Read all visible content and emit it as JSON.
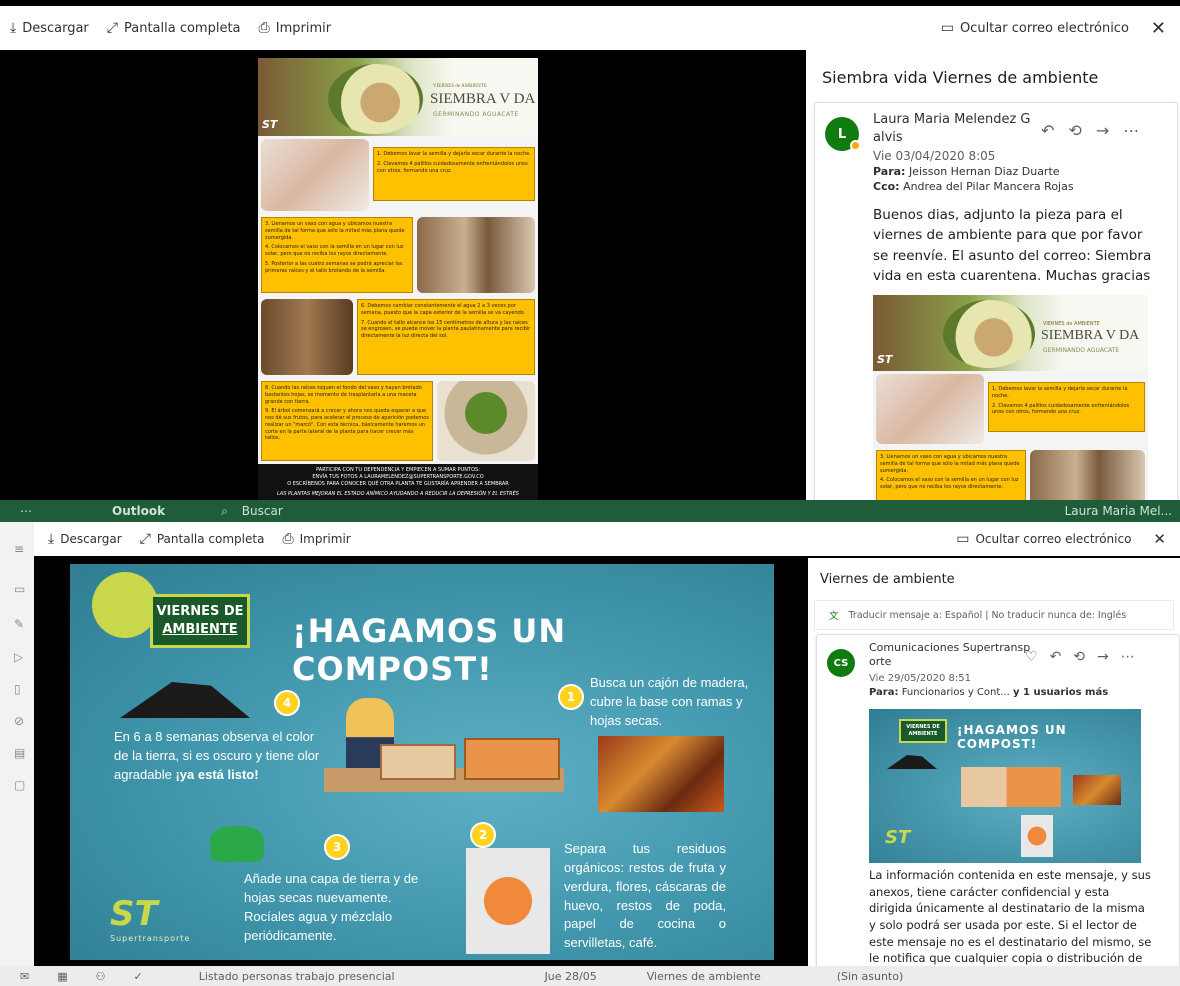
{
  "top_viewer": {
    "toolbar": {
      "download": "Descargar",
      "fullscreen": "Pantalla completa",
      "print": "Imprimir",
      "hide_email": "Ocultar correo electrónico"
    },
    "subject": "Siembra vida Viernes de ambiente",
    "message": {
      "avatar": "L",
      "sender": "Laura Maria Melendez G alvis",
      "sender_line1": "Laura Maria Melendez G",
      "sender_line2": "alvis",
      "date": "Vie 03/04/2020 8:05",
      "to_label": "Para:",
      "to": "Jeisson Hernan Diaz Duarte",
      "cc_label": "Cco:",
      "cc": "Andrea del Pilar Mancera Rojas",
      "body": "Buenos dias, adjunto la pieza para el viernes de ambiente para que por favor se reenvíe. El asunto del correo: Siembra vida en esta cuarentena. Muchas gracias"
    },
    "poster": {
      "header_small": "VIERNES de AMBIENTE",
      "header_big": "SIEMBRA V DA",
      "header_sub": "GERMINANDO AGUACATE",
      "logo": "ST",
      "step1": "1. Debemos lavar la semilla y dejarla secar durante la noche.",
      "step2": "2. Clavamos 4 palillos cuidadosamente enfrentándolos unos con otros, formando una cruz.",
      "step3": "3. Llenamos un vaso con agua y ubicamos nuestra semilla de tal forma que sólo la mitad más plana quede sumergida.",
      "step4": "4. Colocamos el vaso con la semilla en un lugar con luz solar, pero que no reciba los rayos directamente.",
      "step5": "5. Posterior a las cuatro semanas se podrá apreciar las primeras raíces y el tallo brotando de la semilla.",
      "step6": "6. Debemos cambiar constantemente el agua 2 a 3 veces por semana, puesto que la capa exterior de la semilla se va cayendo.",
      "step7": "7. Cuando el tallo alcance los 15 centímetros de altura y las raíces se engrosen, se puede mover la planta paulatinamente para recibir directamente la luz directa del sol.",
      "step8": "8. Cuando las raíces toquen el fondo del vaso y hayan brotado bastantes hojas, es momento de trasplantarla a una maceta grande con tierra.",
      "step9": "9. El árbol comenzará a crecer y ahora nos queda esperar a que nos dé sus frutos, para acelerar el proceso de aparición podemos realizar un \"marcó\". Con esta técnica, básicamente haremos un corte en la parte lateral de la planta para hacer crecer más tallos.",
      "footer1": "PARTICIPA CON TU DEPENDENCIA Y EMPIECEN A SUMAR PUNTOS:",
      "footer2": "ENVÍA TUS FOTOS A LAURAMELENDEZ@SUPERTRANSPORTE.GOV.CO",
      "footer3": "O ESCRÍBENOS PARA CONOCER QUÉ OTRA PLANTA TE GUSTARÍA APRENDER A SEMBRAR",
      "footer4": "LAS PLANTAS MEJORAN EL ESTADO ANÍMICO AYUDANDO A REDUCIR LA DEPRESIÓN Y EL ESTRÉS"
    }
  },
  "outlook_bg": {
    "app_name": "Outlook",
    "search": "Buscar",
    "user": "Laura Maria Mel...",
    "bottom_item": "Listado personas trabajo presencial",
    "bottom_date": "Jue 28/05",
    "bottom_compose": "Viernes de ambiente",
    "bottom_subject": "(Sin asunto)"
  },
  "bottom_viewer": {
    "toolbar": {
      "download": "Descargar",
      "fullscreen": "Pantalla completa",
      "print": "Imprimir",
      "hide_email": "Ocultar correo electrónico"
    },
    "subject": "Viernes de ambiente",
    "translate": "Traducir mensaje a: Español | No traducir nunca de: Inglés",
    "message": {
      "avatar": "CS",
      "sender_line1": "Comunicaciones Supertransp",
      "sender_line2": "orte",
      "date": "Vie 29/05/2020 8:51",
      "to_label": "Para:",
      "to": "Funcionarios y Cont...",
      "to_more": "y 1 usuarios más",
      "body": "La información contenida en este mensaje, y sus anexos, tiene carácter confidencial y esta dirigida únicamente al destinatario de la misma y solo podrá ser usada por este. Si el lector de este mensaje no es el destinatario del mismo, se le notifica que cualquier copia o distribución de este se encuentra totalmente prohibida. Si usted ha recibido este"
    },
    "slide": {
      "badge_line1": "VIERNES DE",
      "badge_line2": "AMBIENTE",
      "title": "¡HAGAMOS UN COMPOST!",
      "n1": "1",
      "n2": "2",
      "n3": "3",
      "n4": "4",
      "step1": "Busca un cajón de madera, cubre la base con ramas y hojas secas.",
      "step2": "Separa tus residuos orgánicos: restos de fruta y verdura, flores, cáscaras de huevo, restos de poda, papel de cocina o servilletas, café.",
      "step3": "Añade una capa de tierra y de hojas secas nuevamente. Rocíales agua y mézclalo periódicamente.",
      "step4": "En 6 a 8 semanas observa el color de la tierra, si es oscuro y tiene olor agradable",
      "step4_bold": "¡ya está listo!",
      "logo": "ST",
      "logo_sub": "Supertransporte"
    }
  }
}
